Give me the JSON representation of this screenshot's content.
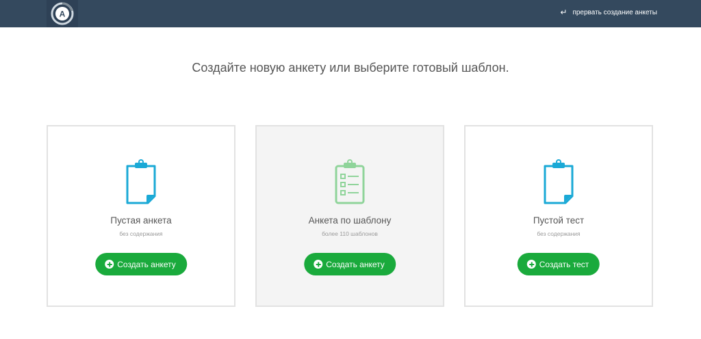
{
  "header": {
    "logo_icon": "logo-icon",
    "logo_letter": "A",
    "back_label": "прервать создание анкеты",
    "back_icon": "return-arrow-icon"
  },
  "main": {
    "title": "Создайте новую анкету или выберите готовый шаблон."
  },
  "cards": [
    {
      "title": "Пустая анкета",
      "subtitle": "без содержания",
      "button_label": "Создать анкету",
      "icon": "blank-clipboard-icon",
      "icon_color": "#1aa9d6"
    },
    {
      "title": "Анкета по шаблону",
      "subtitle": "более 110 шаблонов",
      "button_label": "Создать анкету",
      "icon": "checklist-clipboard-icon",
      "icon_color": "#8fd49a"
    },
    {
      "title": "Пустой тест",
      "subtitle": "без содержания",
      "button_label": "Создать тест",
      "icon": "blank-clipboard-icon",
      "icon_color": "#1aa9d6"
    }
  ],
  "colors": {
    "header_bg": "#34495e",
    "button_green": "#1aaa3c",
    "card_border": "#e2e2e2"
  }
}
